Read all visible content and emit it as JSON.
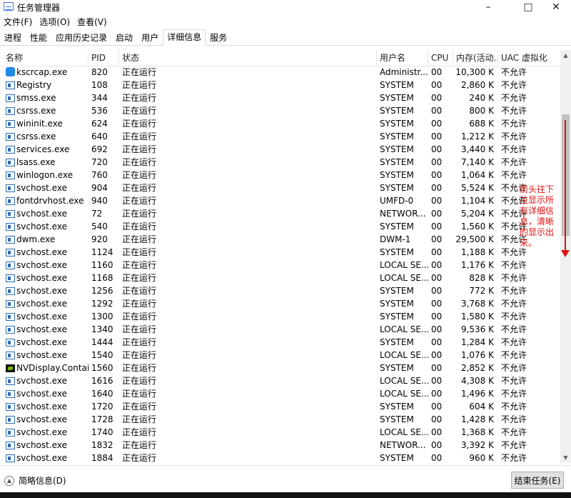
{
  "window": {
    "title": "任务管理器",
    "minimize": "–",
    "maximize": "□",
    "close": "✕"
  },
  "menu": [
    "文件(F)",
    "选项(O)",
    "查看(V)"
  ],
  "tabs": [
    "进程",
    "性能",
    "应用历史记录",
    "启动",
    "用户",
    "详细信息",
    "服务"
  ],
  "active_tab": 5,
  "columns": [
    "名称",
    "PID",
    "状态",
    "用户名",
    "CPU",
    "内存(活动...",
    "UAC 虚拟化"
  ],
  "rows": [
    {
      "icon": "ksc",
      "name": "kscrcap.exe",
      "pid": "820",
      "status": "正在运行",
      "user": "Administr...",
      "cpu": "00",
      "mem": "10,300 K",
      "uac": "不允许"
    },
    {
      "icon": "app",
      "name": "Registry",
      "pid": "108",
      "status": "正在运行",
      "user": "SYSTEM",
      "cpu": "00",
      "mem": "2,860 K",
      "uac": "不允许"
    },
    {
      "icon": "app",
      "name": "smss.exe",
      "pid": "344",
      "status": "正在运行",
      "user": "SYSTEM",
      "cpu": "00",
      "mem": "240 K",
      "uac": "不允许"
    },
    {
      "icon": "app",
      "name": "csrss.exe",
      "pid": "536",
      "status": "正在运行",
      "user": "SYSTEM",
      "cpu": "00",
      "mem": "800 K",
      "uac": "不允许"
    },
    {
      "icon": "app",
      "name": "wininit.exe",
      "pid": "624",
      "status": "正在运行",
      "user": "SYSTEM",
      "cpu": "00",
      "mem": "688 K",
      "uac": "不允许"
    },
    {
      "icon": "app",
      "name": "csrss.exe",
      "pid": "640",
      "status": "正在运行",
      "user": "SYSTEM",
      "cpu": "00",
      "mem": "1,212 K",
      "uac": "不允许"
    },
    {
      "icon": "app",
      "name": "services.exe",
      "pid": "692",
      "status": "正在运行",
      "user": "SYSTEM",
      "cpu": "00",
      "mem": "3,440 K",
      "uac": "不允许"
    },
    {
      "icon": "app",
      "name": "lsass.exe",
      "pid": "720",
      "status": "正在运行",
      "user": "SYSTEM",
      "cpu": "00",
      "mem": "7,140 K",
      "uac": "不允许"
    },
    {
      "icon": "app",
      "name": "winlogon.exe",
      "pid": "760",
      "status": "正在运行",
      "user": "SYSTEM",
      "cpu": "00",
      "mem": "1,064 K",
      "uac": "不允许"
    },
    {
      "icon": "app",
      "name": "svchost.exe",
      "pid": "904",
      "status": "正在运行",
      "user": "SYSTEM",
      "cpu": "00",
      "mem": "5,524 K",
      "uac": "不允许"
    },
    {
      "icon": "app",
      "name": "fontdrvhost.exe",
      "pid": "940",
      "status": "正在运行",
      "user": "UMFD-0",
      "cpu": "00",
      "mem": "1,104 K",
      "uac": "不允许"
    },
    {
      "icon": "app",
      "name": "svchost.exe",
      "pid": "72",
      "status": "正在运行",
      "user": "NETWOR...",
      "cpu": "00",
      "mem": "5,204 K",
      "uac": "不允许"
    },
    {
      "icon": "app",
      "name": "svchost.exe",
      "pid": "540",
      "status": "正在运行",
      "user": "SYSTEM",
      "cpu": "00",
      "mem": "1,560 K",
      "uac": "不允许"
    },
    {
      "icon": "app",
      "name": "dwm.exe",
      "pid": "920",
      "status": "正在运行",
      "user": "DWM-1",
      "cpu": "00",
      "mem": "29,500 K",
      "uac": "不允许"
    },
    {
      "icon": "app",
      "name": "svchost.exe",
      "pid": "1124",
      "status": "正在运行",
      "user": "SYSTEM",
      "cpu": "00",
      "mem": "1,188 K",
      "uac": "不允许"
    },
    {
      "icon": "app",
      "name": "svchost.exe",
      "pid": "1160",
      "status": "正在运行",
      "user": "LOCAL SE...",
      "cpu": "00",
      "mem": "1,176 K",
      "uac": "不允许"
    },
    {
      "icon": "app",
      "name": "svchost.exe",
      "pid": "1168",
      "status": "正在运行",
      "user": "LOCAL SE...",
      "cpu": "00",
      "mem": "828 K",
      "uac": "不允许"
    },
    {
      "icon": "app",
      "name": "svchost.exe",
      "pid": "1256",
      "status": "正在运行",
      "user": "SYSTEM",
      "cpu": "00",
      "mem": "772 K",
      "uac": "不允许"
    },
    {
      "icon": "app",
      "name": "svchost.exe",
      "pid": "1292",
      "status": "正在运行",
      "user": "SYSTEM",
      "cpu": "00",
      "mem": "3,768 K",
      "uac": "不允许"
    },
    {
      "icon": "app",
      "name": "svchost.exe",
      "pid": "1300",
      "status": "正在运行",
      "user": "SYSTEM",
      "cpu": "00",
      "mem": "1,580 K",
      "uac": "不允许"
    },
    {
      "icon": "app",
      "name": "svchost.exe",
      "pid": "1340",
      "status": "正在运行",
      "user": "LOCAL SE...",
      "cpu": "00",
      "mem": "9,536 K",
      "uac": "不允许"
    },
    {
      "icon": "app",
      "name": "svchost.exe",
      "pid": "1444",
      "status": "正在运行",
      "user": "SYSTEM",
      "cpu": "00",
      "mem": "1,284 K",
      "uac": "不允许"
    },
    {
      "icon": "app",
      "name": "svchost.exe",
      "pid": "1540",
      "status": "正在运行",
      "user": "LOCAL SE...",
      "cpu": "00",
      "mem": "1,076 K",
      "uac": "不允许"
    },
    {
      "icon": "nv",
      "name": "NVDisplay.Contain...",
      "pid": "1560",
      "status": "正在运行",
      "user": "SYSTEM",
      "cpu": "00",
      "mem": "2,852 K",
      "uac": "不允许"
    },
    {
      "icon": "app",
      "name": "svchost.exe",
      "pid": "1616",
      "status": "正在运行",
      "user": "LOCAL SE...",
      "cpu": "00",
      "mem": "4,308 K",
      "uac": "不允许"
    },
    {
      "icon": "app",
      "name": "svchost.exe",
      "pid": "1640",
      "status": "正在运行",
      "user": "LOCAL SE...",
      "cpu": "00",
      "mem": "1,496 K",
      "uac": "不允许"
    },
    {
      "icon": "app",
      "name": "svchost.exe",
      "pid": "1720",
      "status": "正在运行",
      "user": "SYSTEM",
      "cpu": "00",
      "mem": "604 K",
      "uac": "不允许"
    },
    {
      "icon": "app",
      "name": "svchost.exe",
      "pid": "1728",
      "status": "正在运行",
      "user": "SYSTEM",
      "cpu": "00",
      "mem": "1,428 K",
      "uac": "不允许"
    },
    {
      "icon": "app",
      "name": "svchost.exe",
      "pid": "1740",
      "status": "正在运行",
      "user": "LOCAL SE...",
      "cpu": "00",
      "mem": "1,368 K",
      "uac": "不允许"
    },
    {
      "icon": "app",
      "name": "svchost.exe",
      "pid": "1832",
      "status": "正在运行",
      "user": "NETWOR...",
      "cpu": "00",
      "mem": "3,392 K",
      "uac": "不允许"
    },
    {
      "icon": "app",
      "name": "svchost.exe",
      "pid": "1884",
      "status": "正在运行",
      "user": "SYSTEM",
      "cpu": "00",
      "mem": "960 K",
      "uac": "不允许"
    }
  ],
  "annotation": "箭头往下拉显示所有详细信息，清晰的显示出来。",
  "footer": {
    "fewer_details": "简略信息(D)",
    "end_task": "结束任务(E)"
  },
  "colors": {
    "annotation": "#dd1111",
    "tab_border": "#d9d9d9"
  }
}
